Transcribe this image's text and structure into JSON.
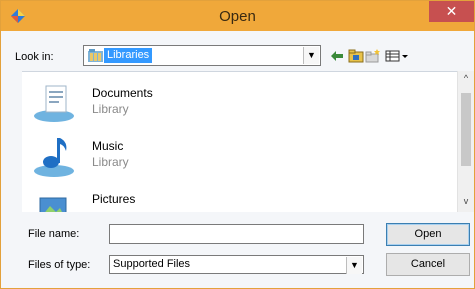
{
  "window": {
    "title": "Open",
    "close_glyph": "✕",
    "app_icon": "java-app-icon"
  },
  "lookin": {
    "label": "Look in:",
    "value": "Libraries",
    "arrow": "▼"
  },
  "toolbar": {
    "icons": [
      "up-one-level-icon",
      "home-folder-icon",
      "new-folder-icon",
      "view-menu-icon"
    ]
  },
  "files": [
    {
      "name": "Documents",
      "type": "Library",
      "icon": "documents-library-icon"
    },
    {
      "name": "Music",
      "type": "Library",
      "icon": "music-library-icon"
    },
    {
      "name": "Pictures",
      "type": "",
      "icon": "pictures-library-icon"
    }
  ],
  "scrollbar": {
    "up": "^",
    "down": "v"
  },
  "filename": {
    "label": "File name:",
    "value": ""
  },
  "filetype": {
    "label": "Files of type:",
    "value": "Supported Files",
    "arrow": "▼"
  },
  "buttons": {
    "open": "Open",
    "cancel": "Cancel"
  },
  "colors": {
    "titlebar": "#f0a83a",
    "close": "#c75050",
    "selection": "#3399ff"
  }
}
